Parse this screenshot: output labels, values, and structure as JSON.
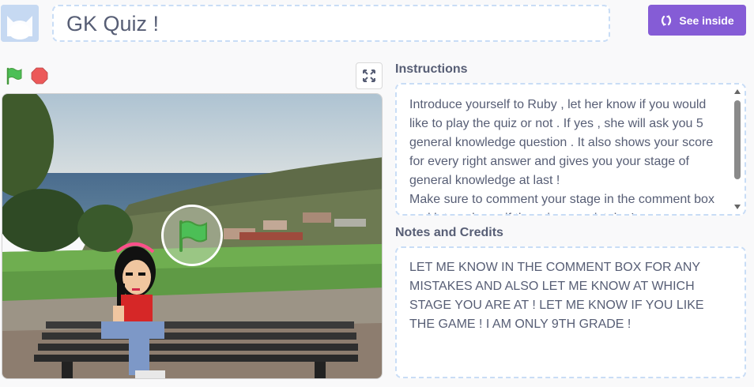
{
  "project": {
    "title": "GK Quiz !",
    "see_inside_label": "See inside"
  },
  "player": {
    "controls": [
      "green-flag-icon",
      "stop-icon",
      "fullscreen-icon"
    ]
  },
  "instructions": {
    "label": "Instructions",
    "text": "Introduce yourself to Ruby , let her know if you would like to play the quiz or not . If yes , she will ask you 5 general knowledge question . It  also shows your score for every right answer and gives you your stage of general knowledge at last !\nMake sure to comment your stage in the comment box and let me know if there is any mistake !"
  },
  "notes": {
    "label": "Notes and Credits",
    "text": "LET ME KNOW IN THE COMMENT BOX FOR ANY MISTAKES AND ALSO LET ME KNOW AT WHICH STAGE YOU ARE AT ! LET ME KNOW IF YOU LIKE THE GAME ! I AM ONLY 9TH GRADE !"
  },
  "colors": {
    "accent": "#855cd6",
    "flag_green": "#4cbf56",
    "stop_red": "#ec5959",
    "dashed_border": "#c9ddf6"
  }
}
